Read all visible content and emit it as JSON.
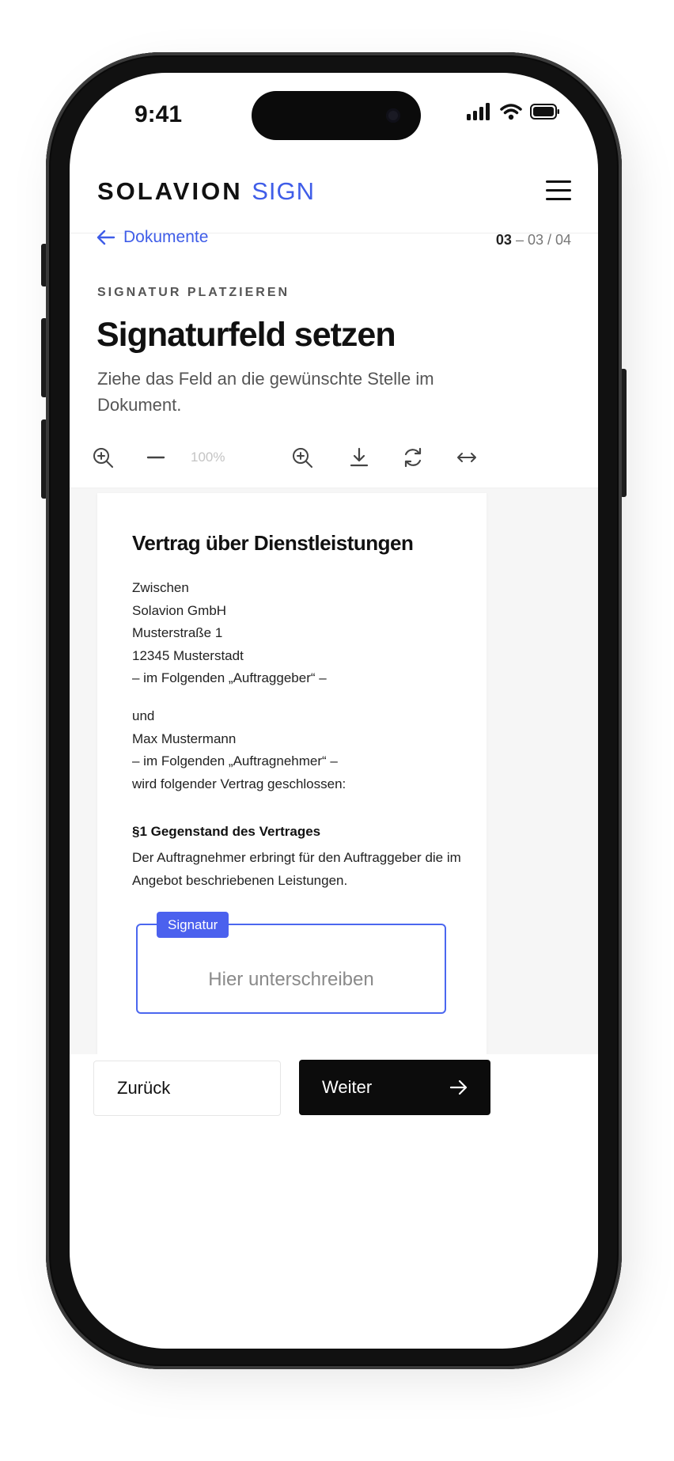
{
  "status_bar": {
    "time": "9:41"
  },
  "header": {
    "brand_main": "SOLAVION",
    "brand_accent": "SIGN"
  },
  "nav": {
    "back_label": "Dokumente",
    "step_current": "03",
    "step_rest": "– 03 / 04"
  },
  "intro": {
    "eyebrow": "SIGNATUR PLATZIEREN",
    "title": "Signaturfeld setzen",
    "subtitle": "Ziehe das Feld an die gewünschte Stelle im Dokument."
  },
  "toolbar": {
    "zoom_level": "100%",
    "icons": [
      "zoom-in-icon",
      "minus-icon",
      "zoom-in-icon",
      "download-icon",
      "rotate-icon",
      "fit-width-icon"
    ]
  },
  "document": {
    "title": "Vertrag über Dienstleistungen",
    "party_a": [
      "Zwischen",
      "Solavion GmbH",
      "Musterstraße 1",
      "12345 Musterstadt",
      "– im Folgenden „Auftraggeber“ –"
    ],
    "party_b": [
      "und",
      "Max Mustermann",
      "– im Folgenden „Auftragnehmer“ –",
      "wird folgender Vertrag geschlossen:"
    ],
    "section_title": "§1 Gegenstand des Vertrages",
    "section_text": "Der Auftragnehmer erbringt für den Auftraggeber die im Angebot beschriebenen Leistungen."
  },
  "signature": {
    "tag": "Signatur",
    "placeholder": "Hier unterschreiben"
  },
  "actions": {
    "back": "Zurück",
    "next": "Weiter"
  },
  "colors": {
    "accent": "#3f5de8",
    "primary_button": "#0c0c0c"
  }
}
